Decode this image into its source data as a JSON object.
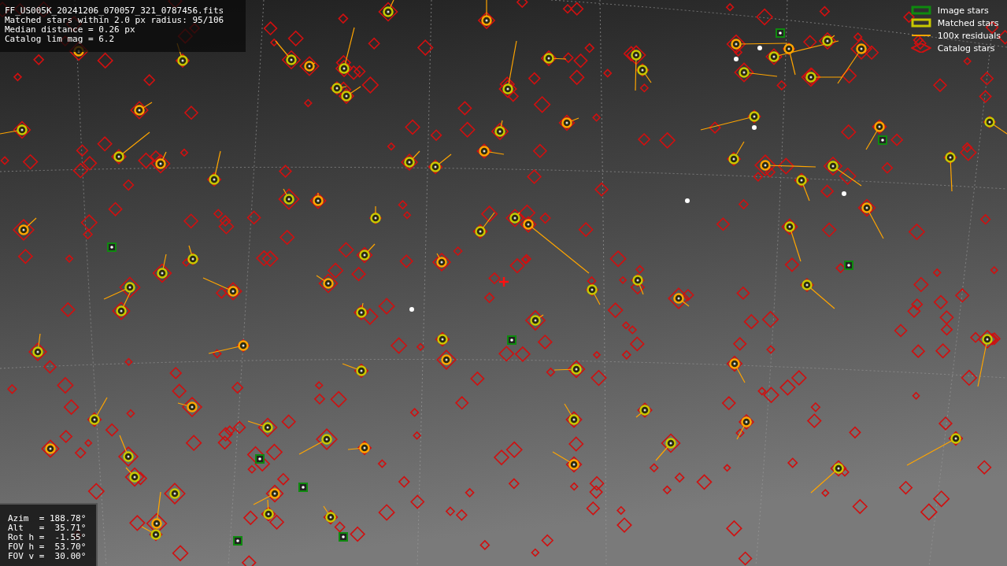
{
  "info": {
    "lines": [
      "FF_US005K_20241206_070057_321_0787456.fits",
      "Matched stars within 2.0 px radius: 95/106",
      "Median distance = 0.26 px",
      "Catalog lim mag = 6.2"
    ]
  },
  "legend": [
    {
      "kind": "image",
      "label": "Image stars",
      "color": "#0f8a0f"
    },
    {
      "kind": "matched",
      "label": "Matched stars",
      "color": "#c8c800"
    },
    {
      "kind": "residual",
      "label": "100x residuals",
      "color": "#ffa500"
    },
    {
      "kind": "catalog",
      "label": "Catalog stars",
      "color": "#d01010"
    }
  ],
  "orientation": {
    "lines": [
      "Azim  = 188.78°",
      "Alt   =  35.71°",
      "Rot h =  -1.55°",
      "FOV h =  53.70°",
      "FOV v =  30.00°"
    ]
  }
}
